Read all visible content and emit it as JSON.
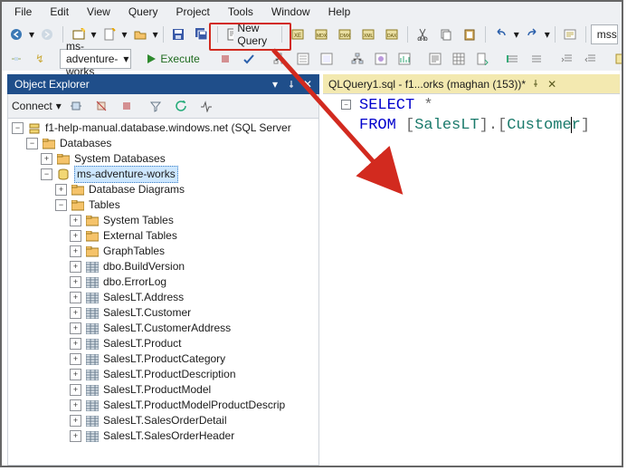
{
  "menubar": [
    "File",
    "Edit",
    "View",
    "Query",
    "Project",
    "Tools",
    "Window",
    "Help"
  ],
  "toolbar1": {
    "new_query_label": "New Query",
    "combo_right": "msservi"
  },
  "toolbar2": {
    "db_combo": "ms-adventure-works",
    "execute_label": "Execute"
  },
  "object_explorer": {
    "title": "Object Explorer",
    "connect_label": "Connect",
    "root": "f1-help-manual.database.windows.net (SQL Server ",
    "databases": "Databases",
    "sysdb": "System Databases",
    "selected_db": "ms-adventure-works",
    "diagrams": "Database Diagrams",
    "tables": "Tables",
    "systables": "System Tables",
    "exttables": "External Tables",
    "graphtables": "GraphTables",
    "t1": "dbo.BuildVersion",
    "t2": "dbo.ErrorLog",
    "t3": "SalesLT.Address",
    "t4": "SalesLT.Customer",
    "t5": "SalesLT.CustomerAddress",
    "t6": "SalesLT.Product",
    "t7": "SalesLT.ProductCategory",
    "t8": "SalesLT.ProductDescription",
    "t9": "SalesLT.ProductModel",
    "t10": "SalesLT.ProductModelProductDescrip",
    "t11": "SalesLT.SalesOrderDetail",
    "t12": "SalesLT.SalesOrderHeader"
  },
  "editor": {
    "tab": "QLQuery1.sql - f1...orks (maghan (153))*",
    "code": {
      "select_kw": "SELECT",
      "star": " *",
      "from_kw": "FROM",
      "space": " ",
      "b1": "[",
      "schema": "SalesLT",
      "b2": "]",
      "dot": ".",
      "b3": "[",
      "obj_pre": "Custome",
      "obj_post": "r",
      "b4": "]"
    }
  }
}
